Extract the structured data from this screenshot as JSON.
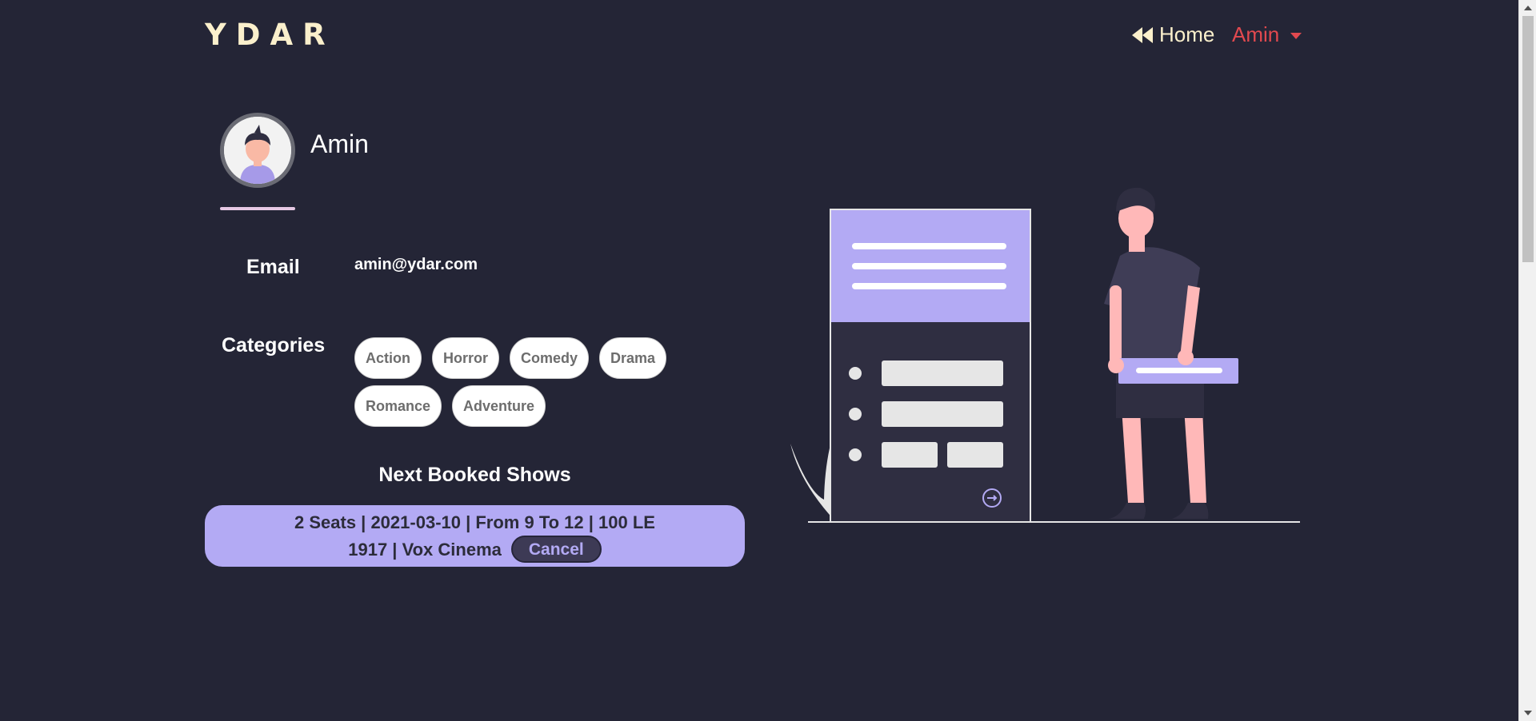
{
  "navbar": {
    "logo": "YDAR",
    "home_label": "Home",
    "user_label": "Amin"
  },
  "profile": {
    "name": "Amin",
    "email_label": "Email",
    "email": "amin@ydar.com",
    "categories_label": "Categories",
    "categories": [
      "Action",
      "Horror",
      "Comedy",
      "Drama",
      "Romance",
      "Adventure"
    ]
  },
  "bookings": {
    "title": "Next Booked Shows",
    "items": [
      {
        "line1": "2 Seats | 2021-03-10 | From 9 To 12 | 100 LE",
        "line2": "1917 | Vox Cinema",
        "cancel_label": "Cancel"
      }
    ]
  },
  "colors": {
    "background": "#242536",
    "logo": "#fbf0cc",
    "user_accent": "#e2494f",
    "card": "#b3aaf4",
    "cancel_button": "#3d3a55"
  },
  "icons": {
    "home": "double-left-chevron-icon",
    "user_menu": "caret-down-icon",
    "avatar": "user-avatar-illustration",
    "illustration": "person-with-form-illustration"
  }
}
